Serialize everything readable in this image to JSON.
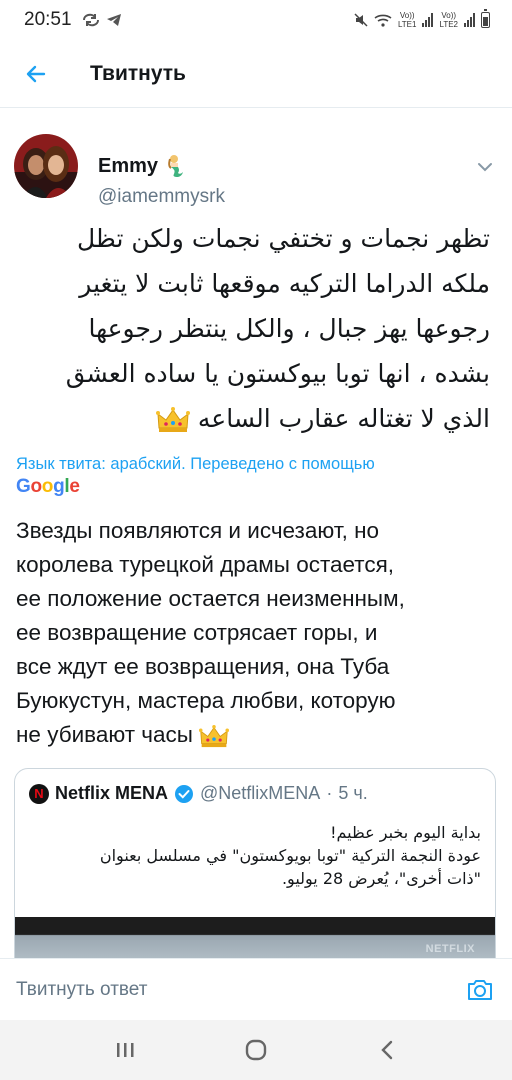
{
  "status_bar": {
    "time": "20:51",
    "sim1_label": "LTE1",
    "sim2_label": "LTE2",
    "volte1": "Vo))",
    "volte2": "Vo))"
  },
  "header": {
    "title": "Твитнуть"
  },
  "tweet": {
    "author_name": "Emmy",
    "author_handle": "@iamemmysrk",
    "text_lines": [
      "تظهر نجمات و تختفي نجمات ولكن تظل",
      "ملكه الدراما التركيه موقعها ثابت لا يتغير",
      "رجوعها يهز جبال ، والكل ينتظر رجوعها",
      "بشده ، انها توبا بيوكستون يا ساده العشق",
      "الذي لا تغتاله عقارب الساعه"
    ],
    "translated_by": "Язык твита: арабский. Переведено с помощью",
    "translation_provider": "Google",
    "translation_lines": [
      "Звезды появляются и исчезают, но",
      "королева турецкой драмы остается,",
      "ее положение остается неизменным,",
      "ее возвращение сотрясает горы, и",
      "все ждут ее возвращения, она Туба",
      "Буюкустун, мастера любви, которую",
      "не убивают часы"
    ]
  },
  "quote": {
    "name": "Netflix MENA",
    "handle": "@NetflixMENA",
    "separator": "·",
    "time": "5 ч.",
    "text_lines": [
      "بداية اليوم بخبر عظيم!",
      "عودة النجمة التركية \"توبا بويوكستون\" في مسلسل بعنوان",
      "\"ذات أخرى\"، يُعرض 28 يوليو."
    ],
    "media_brand": "NETFLIX"
  },
  "reply": {
    "placeholder": "Твитнуть ответ"
  },
  "colors": {
    "accent": "#1da1f2",
    "text": "#14171a",
    "secondary": "#657786",
    "border": "#e6ecf0"
  },
  "icons": {
    "back": "arrow-left-icon",
    "caret": "chevron-down-icon",
    "camera": "camera-icon",
    "verified": "verified-badge-icon",
    "crown": "crown-emoji-icon"
  }
}
